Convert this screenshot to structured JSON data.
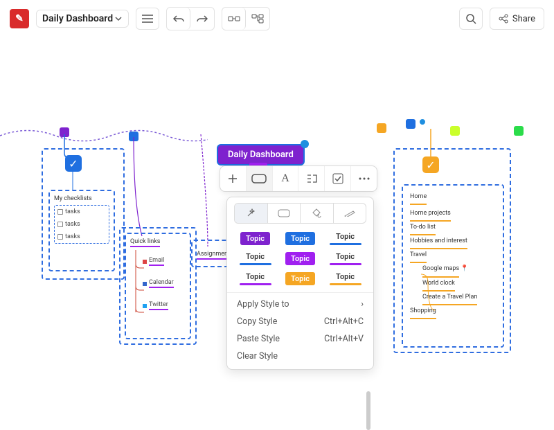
{
  "header": {
    "title": "Daily Dashboard",
    "share_label": "Share"
  },
  "root_node": "Daily Dashboard",
  "style_panel": {
    "topics": [
      {
        "label": "Topic",
        "variant": "box",
        "bg": "#7e22ce",
        "fg": "#fff"
      },
      {
        "label": "Topic",
        "variant": "box",
        "bg": "#1f6fe0",
        "fg": "#fff"
      },
      {
        "label": "Topic",
        "variant": "underline",
        "color": "#1f6fe0"
      },
      {
        "label": "Topic",
        "variant": "underline",
        "color": "#1f6fe0"
      },
      {
        "label": "Topic",
        "variant": "box",
        "bg": "#a020f0",
        "fg": "#fff"
      },
      {
        "label": "Topic",
        "variant": "underline",
        "color": "#a020f0"
      },
      {
        "label": "Topic",
        "variant": "underline",
        "color": "#a020f0"
      },
      {
        "label": "Topic",
        "variant": "box",
        "bg": "#f5a623",
        "fg": "#fff"
      },
      {
        "label": "Topic",
        "variant": "underline",
        "color": "#f5a623"
      }
    ],
    "menu": {
      "apply": "Apply Style to",
      "copy": "Copy Style",
      "copy_sc": "Ctrl+Alt+C",
      "paste": "Paste Style",
      "paste_sc": "Ctrl+Alt+V",
      "clear": "Clear Style"
    }
  },
  "left_section": {
    "header": "My checklists",
    "items": [
      "tasks",
      "tasks",
      "tasks"
    ]
  },
  "quick_links": {
    "header": "Quick links",
    "items": [
      "Email",
      "Calendar",
      "Twitter"
    ]
  },
  "assignments": {
    "header": "Assignments"
  },
  "right_section": {
    "header": "Home",
    "items": [
      "Home projects",
      "To-do list",
      "Hobbies and interest",
      "Travel"
    ],
    "travel_sub": [
      "Google maps",
      "World clock",
      "Create a Travel Plan"
    ],
    "footer": "Shopping"
  }
}
